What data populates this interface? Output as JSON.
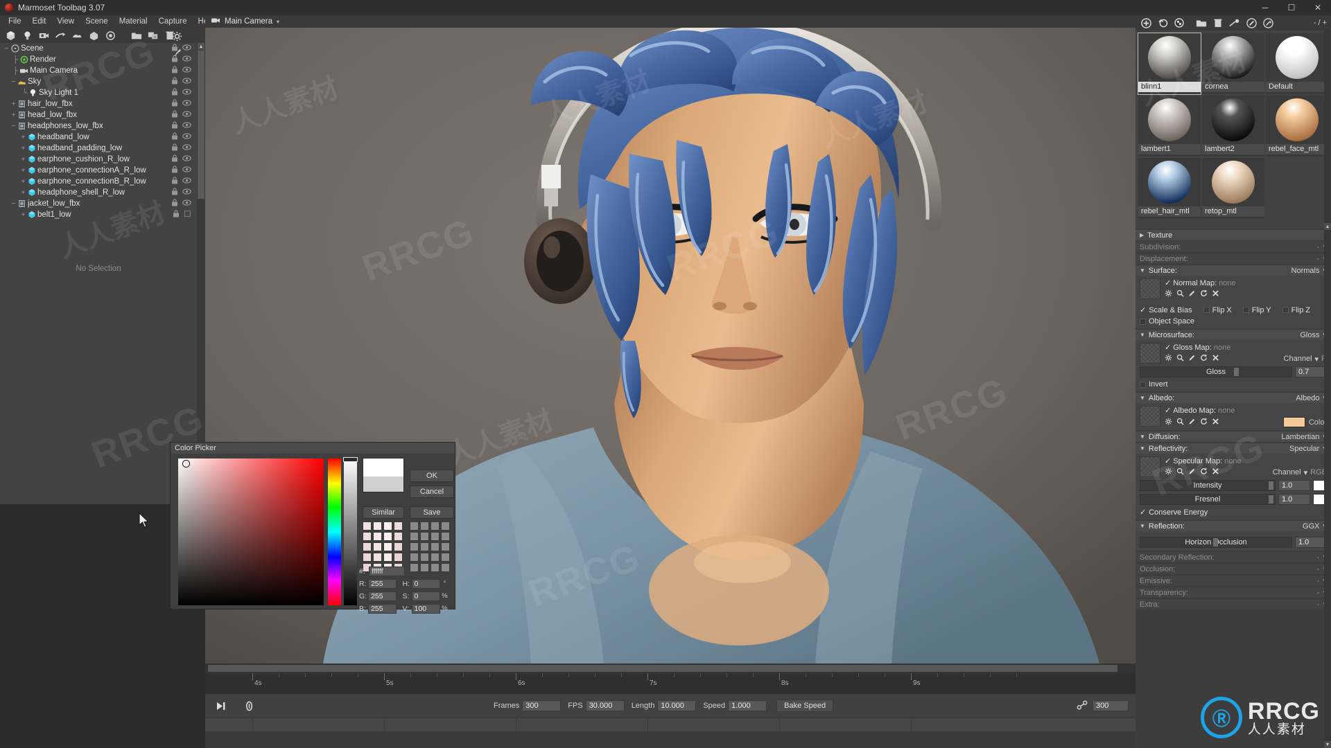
{
  "window": {
    "title": "Marmoset Toolbag 3.07",
    "controls": {
      "minimize": "─",
      "maximize": "☐",
      "close": "✕"
    }
  },
  "menubar": {
    "items": [
      "File",
      "Edit",
      "View",
      "Scene",
      "Material",
      "Capture",
      "Help"
    ]
  },
  "left_toolbar": {
    "icons": [
      "mesh-icon",
      "light-icon",
      "camera-icon",
      "turntable-icon",
      "sky-icon",
      "object-icon",
      "render-icon",
      "open-folder-icon",
      "duplicate-icon",
      "delete-icon"
    ]
  },
  "viewport_tab": {
    "icon": "camera-icon",
    "label": "Main Camera",
    "caret": "▾"
  },
  "viewport_gutter": {
    "icons": [
      "gear-icon",
      "brush-icon"
    ]
  },
  "scene_tree": {
    "no_selection_text": "No Selection",
    "items": [
      {
        "label": "Scene",
        "depth": 0,
        "expander": "−",
        "icon": "scene-icon",
        "icon_color": "#c0c0c0"
      },
      {
        "label": "Render",
        "depth": 1,
        "expander": "",
        "icon": "render-icon",
        "icon_color": "#63c449"
      },
      {
        "label": "Main Camera",
        "depth": 1,
        "expander": "",
        "icon": "camera-icon",
        "icon_color": "#d5d5d5"
      },
      {
        "label": "Sky",
        "depth": 1,
        "expander": "−",
        "icon": "sky-icon",
        "icon_color": "#e7c14e"
      },
      {
        "label": "Sky Light 1",
        "depth": 2,
        "expander": "",
        "icon": "light-icon",
        "icon_color": "#f0f0f0"
      },
      {
        "label": "hair_low_fbx",
        "depth": 1,
        "expander": "+",
        "icon": "file-icon",
        "icon_color": "#9aa7b0"
      },
      {
        "label": "head_low_fbx",
        "depth": 1,
        "expander": "+",
        "icon": "file-icon",
        "icon_color": "#9aa7b0"
      },
      {
        "label": "headphones_low_fbx",
        "depth": 1,
        "expander": "−",
        "icon": "file-icon",
        "icon_color": "#9aa7b0"
      },
      {
        "label": "headband_low",
        "depth": 2,
        "expander": "+",
        "icon": "mesh-icon",
        "icon_color": "#3fc6e8"
      },
      {
        "label": "headband_padding_low",
        "depth": 2,
        "expander": "+",
        "icon": "mesh-icon",
        "icon_color": "#3fc6e8"
      },
      {
        "label": "earphone_cushion_R_low",
        "depth": 2,
        "expander": "+",
        "icon": "mesh-icon",
        "icon_color": "#3fc6e8"
      },
      {
        "label": "earphone_connectionA_R_low",
        "depth": 2,
        "expander": "+",
        "icon": "mesh-icon",
        "icon_color": "#3fc6e8"
      },
      {
        "label": "earphone_connectionB_R_low",
        "depth": 2,
        "expander": "+",
        "icon": "mesh-icon",
        "icon_color": "#3fc6e8"
      },
      {
        "label": "headphone_shell_R_low",
        "depth": 2,
        "expander": "+",
        "icon": "mesh-icon",
        "icon_color": "#3fc6e8"
      },
      {
        "label": "jacket_low_fbx",
        "depth": 1,
        "expander": "−",
        "icon": "file-icon",
        "icon_color": "#9aa7b0"
      },
      {
        "label": "belt1_low",
        "depth": 2,
        "expander": "+",
        "icon": "mesh-icon",
        "icon_color": "#3fc6e8"
      }
    ]
  },
  "color_picker": {
    "title": "Color Picker",
    "buttons": {
      "ok": "OK",
      "cancel": "Cancel",
      "similar": "Similar",
      "save": "Save"
    },
    "fields": {
      "hex_label": "#:",
      "hex_value": "ffffff",
      "r_label": "R:",
      "r_value": "255",
      "g_label": "G:",
      "g_value": "255",
      "b_label": "B:",
      "b_value": "255",
      "h_label": "H:",
      "h_value": "0",
      "h_unit": "°",
      "s_label": "S:",
      "s_value": "0",
      "s_unit": "%",
      "v_label": "V:",
      "v_value": "100",
      "v_unit": "%"
    },
    "current_color": "#ffffff",
    "previous_color": "#cfcfcf",
    "similar_swatches": [
      "#f2e2e2",
      "#f6eaea",
      "#fbf4f4",
      "#efdcdc",
      "#f0dede",
      "#f5e8e8",
      "#faf2f2",
      "#eedada",
      "#eedada",
      "#f3e5e5",
      "#f8f0f0",
      "#ecd7d7",
      "#ecd8d8",
      "#f1e2e2",
      "#f7eeee",
      "#ead4d4",
      "#ead6d6",
      "#efdfdf",
      "#f5ebeb",
      "#e8d1d1"
    ],
    "saved_swatches": [
      "#8a8a8a",
      "#8a8a8a",
      "#8a8a8a",
      "#8a8a8a",
      "#8a8a8a",
      "#8a8a8a",
      "#8a8a8a",
      "#8a8a8a",
      "#8a8a8a",
      "#8a8a8a",
      "#8a8a8a",
      "#8a8a8a",
      "#8a8a8a",
      "#8a8a8a",
      "#8a8a8a",
      "#8a8a8a",
      "#8a8a8a",
      "#8a8a8a",
      "#8a8a8a",
      "#8a8a8a"
    ]
  },
  "timeline": {
    "tick_labels": [
      "4s",
      "5s",
      "6s",
      "7s",
      "8s",
      "9s"
    ],
    "play_icon": "play-to-end-icon",
    "loop_icon": "loop-icon",
    "link_icon": "link-icon",
    "fields": [
      {
        "label": "Frames",
        "value": "300"
      },
      {
        "label": "FPS",
        "value": "30.000"
      },
      {
        "label": "Length",
        "value": "10.000"
      },
      {
        "label": "Speed",
        "value": "1.000"
      }
    ],
    "bake_speed_label": "Bake Speed",
    "right_value": "300"
  },
  "right_panel": {
    "toolbar": {
      "icons": [
        "add-material-icon",
        "duplicate-material-icon",
        "checker-icon",
        "open-folder-icon",
        "delete-icon",
        "assign-icon",
        "paint-icon",
        "eyedropper-icon"
      ],
      "pager": "- / +"
    },
    "materials": [
      {
        "name": "blinn1",
        "selected": true,
        "color_a": "#d8d8d4",
        "color_b": "#55524e"
      },
      {
        "name": "cornea",
        "selected": false,
        "color_a": "#bdbdbd",
        "color_b": "#1c1c1c"
      },
      {
        "name": "Default",
        "selected": false,
        "color_a": "#ffffff",
        "color_b": "#c3c3c3"
      },
      {
        "name": "lambert1",
        "selected": false,
        "color_a": "#d6cec9",
        "color_b": "#6f6660"
      },
      {
        "name": "lambert2",
        "selected": false,
        "color_a": "#555555",
        "color_b": "#0b0b0b"
      },
      {
        "name": "rebel_face_mtl",
        "selected": false,
        "color_a": "#f6cfa2",
        "color_b": "#a96f40"
      },
      {
        "name": "rebel_hair_mtl",
        "selected": false,
        "color_a": "#b9cfe8",
        "color_b": "#12315c"
      },
      {
        "name": "retop_mtl",
        "selected": false,
        "color_a": "#f0ddc8",
        "color_b": "#9d7c5c"
      }
    ],
    "sections": {
      "texture": {
        "caret": "▶",
        "label": "Texture",
        "value": ""
      },
      "subdivision": {
        "label": "Subdivision:",
        "value": "-",
        "caret": "▾",
        "dim": true
      },
      "displacement": {
        "label": "Displacement:",
        "value": "-",
        "caret": "▾",
        "dim": true
      },
      "surface": {
        "caret": "▼",
        "label": "Surface:",
        "value": "Normals",
        "map_label": "Normal Map:",
        "map_value": "none",
        "map_tools": [
          "gear-icon",
          "search-icon",
          "pencil-icon",
          "refresh-icon",
          "close-icon"
        ],
        "checks": [
          {
            "label": "Scale & Bias",
            "checked": true
          },
          {
            "label": "Flip X",
            "checked": false
          },
          {
            "label": "Flip Y",
            "checked": false
          },
          {
            "label": "Flip Z",
            "checked": false
          }
        ],
        "object_space": {
          "label": "Object Space",
          "checked": false
        }
      },
      "microsurface": {
        "caret": "▼",
        "label": "Microsurface:",
        "value": "Gloss",
        "map_label": "Gloss Map:",
        "map_value": "none",
        "channel_label": "Channel",
        "channel_value": "R",
        "slider_label": "Gloss",
        "slider_value": "0.7",
        "invert": {
          "label": "Invert",
          "checked": false
        }
      },
      "albedo": {
        "caret": "▼",
        "label": "Albedo:",
        "value": "Albedo",
        "map_label": "Albedo Map:",
        "map_value": "none",
        "color_label": "Color",
        "color_value": "#f6c99a"
      },
      "diffusion": {
        "caret": "▼",
        "label": "Diffusion:",
        "value": "Lambertian"
      },
      "reflectivity": {
        "caret": "▼",
        "label": "Reflectivity:",
        "value": "Specular",
        "map_label": "Specular Map:",
        "map_value": "none",
        "channel_label": "Channel",
        "channel_value": "RGB",
        "rows": [
          {
            "label": "Intensity",
            "value": "1.0",
            "color": "#ffffff"
          },
          {
            "label": "Fresnel",
            "value": "1.0",
            "color": "#ffffff"
          }
        ],
        "conserve_energy": {
          "label": "Conserve Energy",
          "checked": true
        }
      },
      "reflection": {
        "caret": "▼",
        "label": "Reflection:",
        "value": "GGX",
        "slider_label": "Horizon Occlusion",
        "slider_value": "1.0"
      },
      "secondary_reflection": {
        "label": "Secondary Reflection:",
        "value": "-",
        "caret": "▾",
        "dim": true
      },
      "occlusion": {
        "label": "Occlusion:",
        "value": "-",
        "caret": "▾",
        "dim": true
      },
      "emissive": {
        "label": "Emissive:",
        "value": "-",
        "caret": "▾",
        "dim": true
      },
      "transparency": {
        "label": "Transparency:",
        "value": "-",
        "caret": "▾",
        "dim": true
      },
      "extra": {
        "label": "Extra:",
        "value": "-",
        "caret": "▾",
        "dim": true
      }
    }
  },
  "watermark": {
    "rrcg": "RRCG",
    "cn": "人人素材"
  },
  "logo": {
    "mark": "Ⓡ",
    "name": "RRCG",
    "sub": "人人素材"
  }
}
